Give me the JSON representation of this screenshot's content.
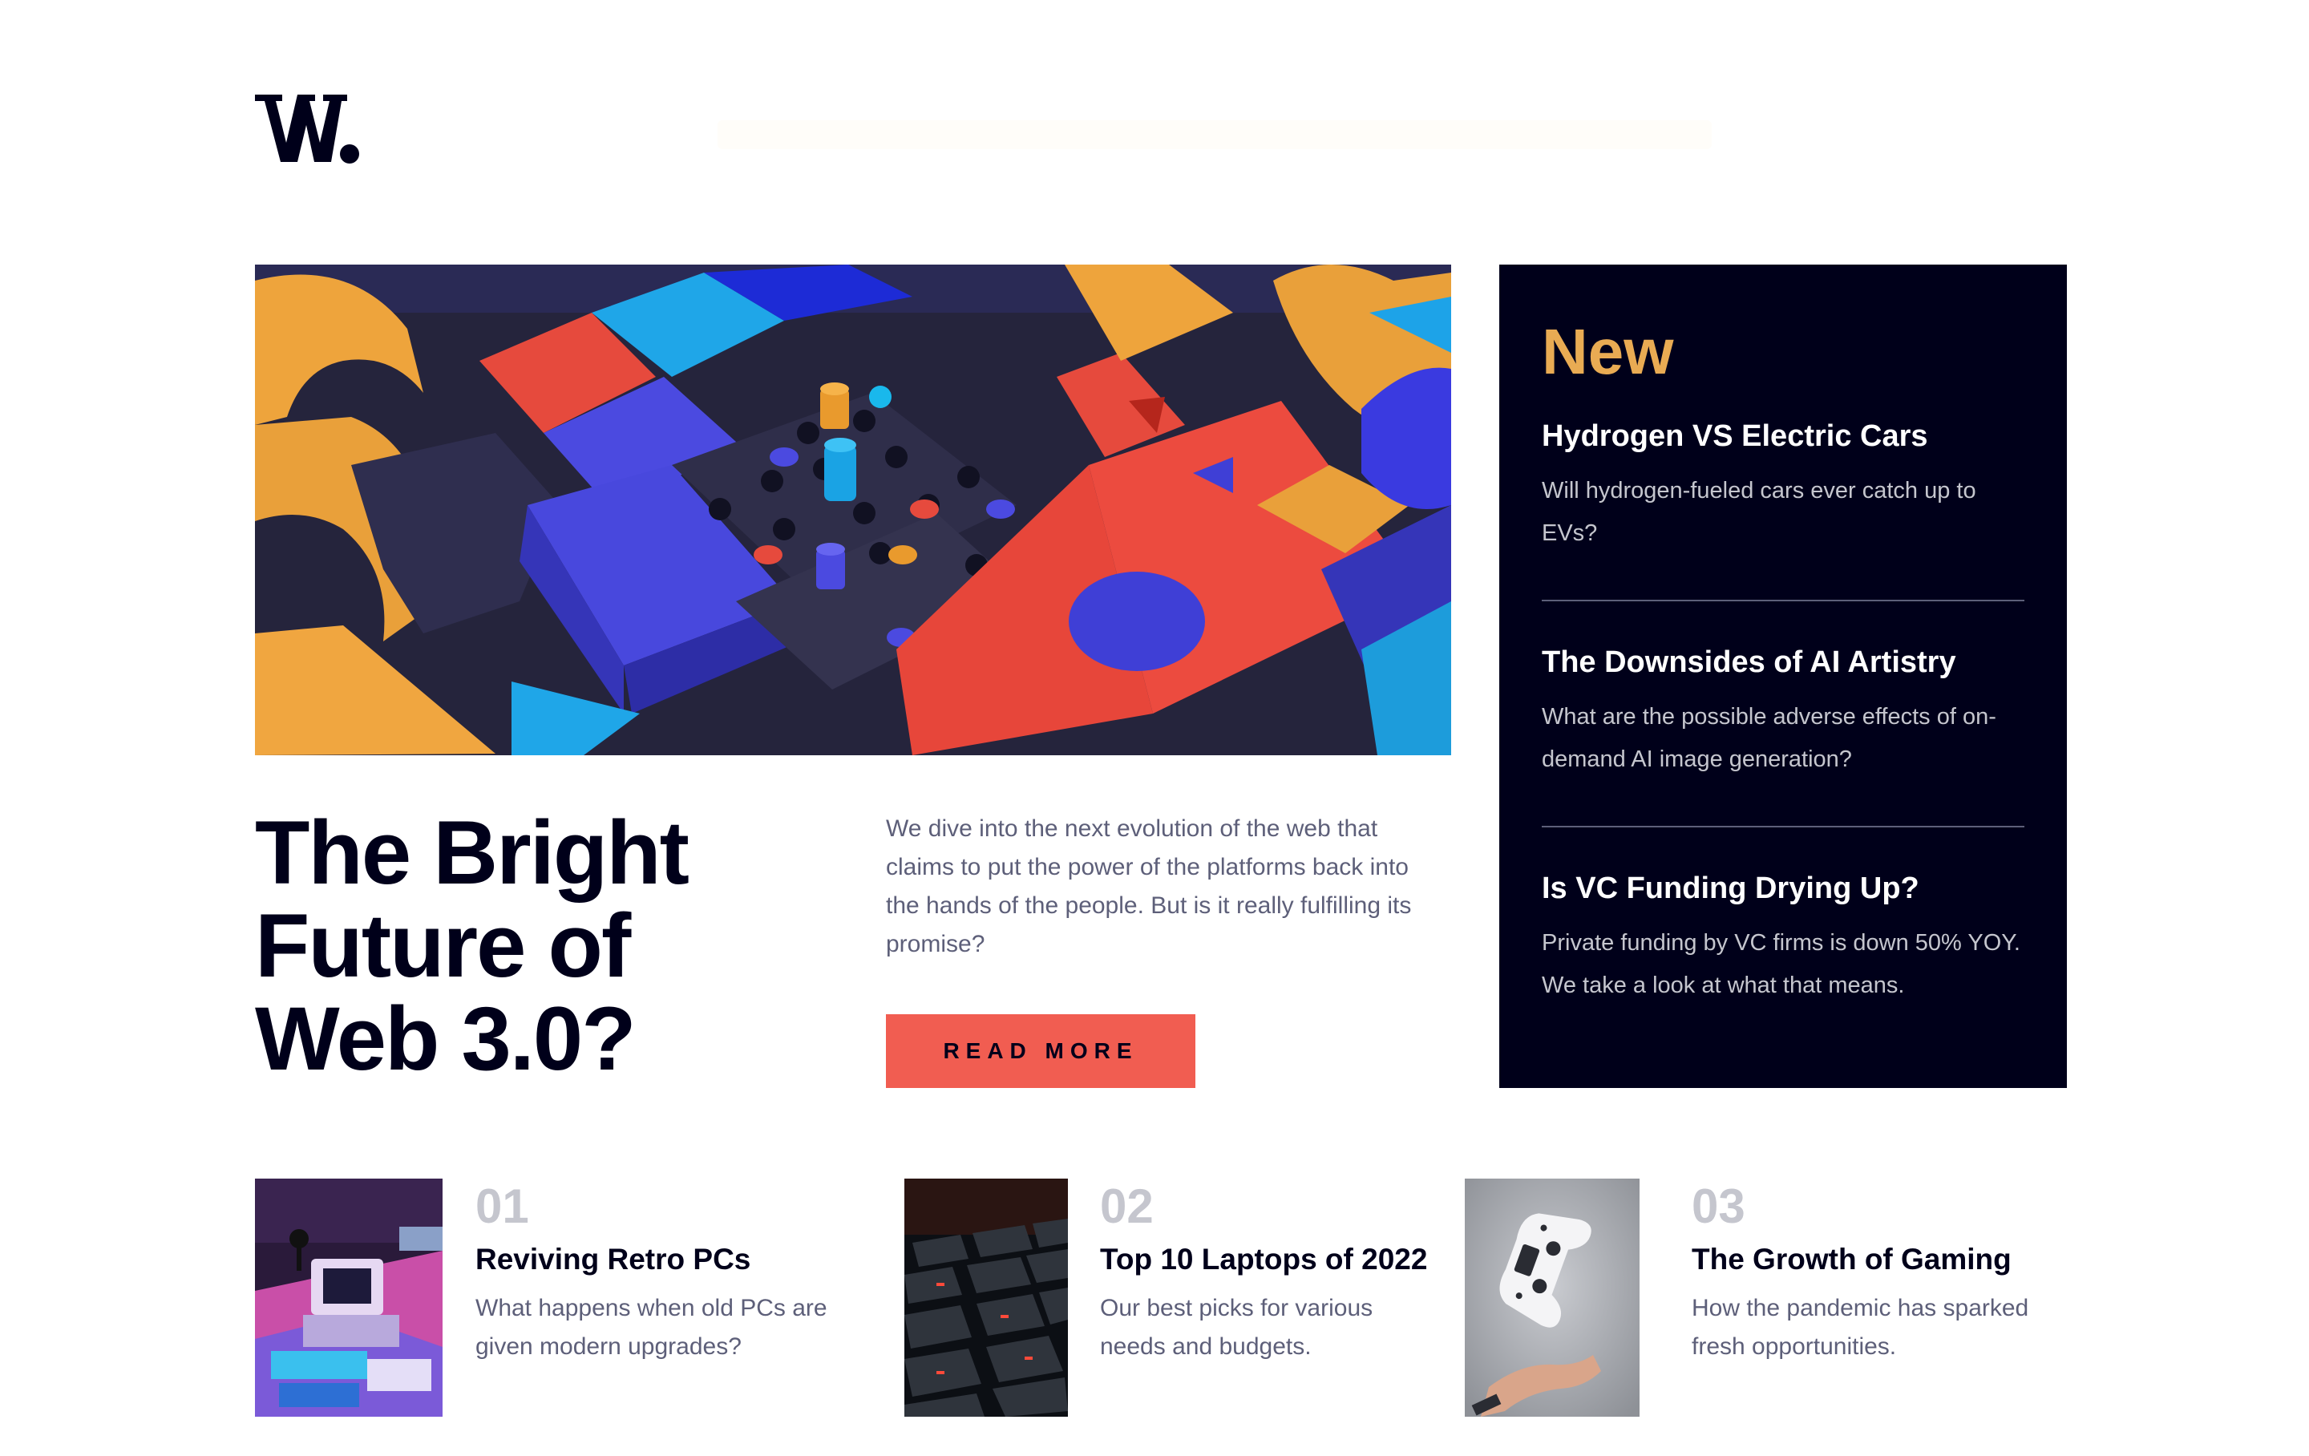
{
  "header": {
    "logo_alt": "W."
  },
  "hero": {
    "title": "The Bright\nFuture of\nWeb 3.0?",
    "description": "We dive into the next evolution of the web that claims to put the power of the platforms back into the hands of the people. But is it really fulfilling its promise?",
    "button_label": "READ MORE",
    "image_icon": "abstract-3d-blocks-image"
  },
  "new_panel": {
    "heading": "New",
    "items": [
      {
        "title": "Hydrogen VS Electric Cars",
        "description": "Will hydrogen-fueled cars ever catch up to EVs?"
      },
      {
        "title": "The Downsides of AI Artistry",
        "description": "What are the possible adverse effects of on-demand AI image generation?"
      },
      {
        "title": "Is VC Funding Drying Up?",
        "description": "Private funding by VC firms is down 50% YOY. We take a look at what that means."
      }
    ]
  },
  "articles": [
    {
      "number": "01",
      "title": "Reviving Retro PCs",
      "description": "What happens when old PCs are given modern upgrades?",
      "image_icon": "retro-pc-image"
    },
    {
      "number": "02",
      "title": "Top 10 Laptops of 2022",
      "description": "Our best picks for various needs and budgets.",
      "image_icon": "keyboard-image"
    },
    {
      "number": "03",
      "title": "The Growth of Gaming",
      "description": "How the pandemic has sparked fresh opportunities.",
      "image_icon": "gamepad-image"
    }
  ],
  "colors": {
    "dark_navy": "#00001a",
    "soft_orange": "#e9ab53",
    "soft_red": "#f15d51",
    "grayish_blue": "#5d5f79",
    "light_gray": "#c5c6ce",
    "white": "#ffffff"
  }
}
